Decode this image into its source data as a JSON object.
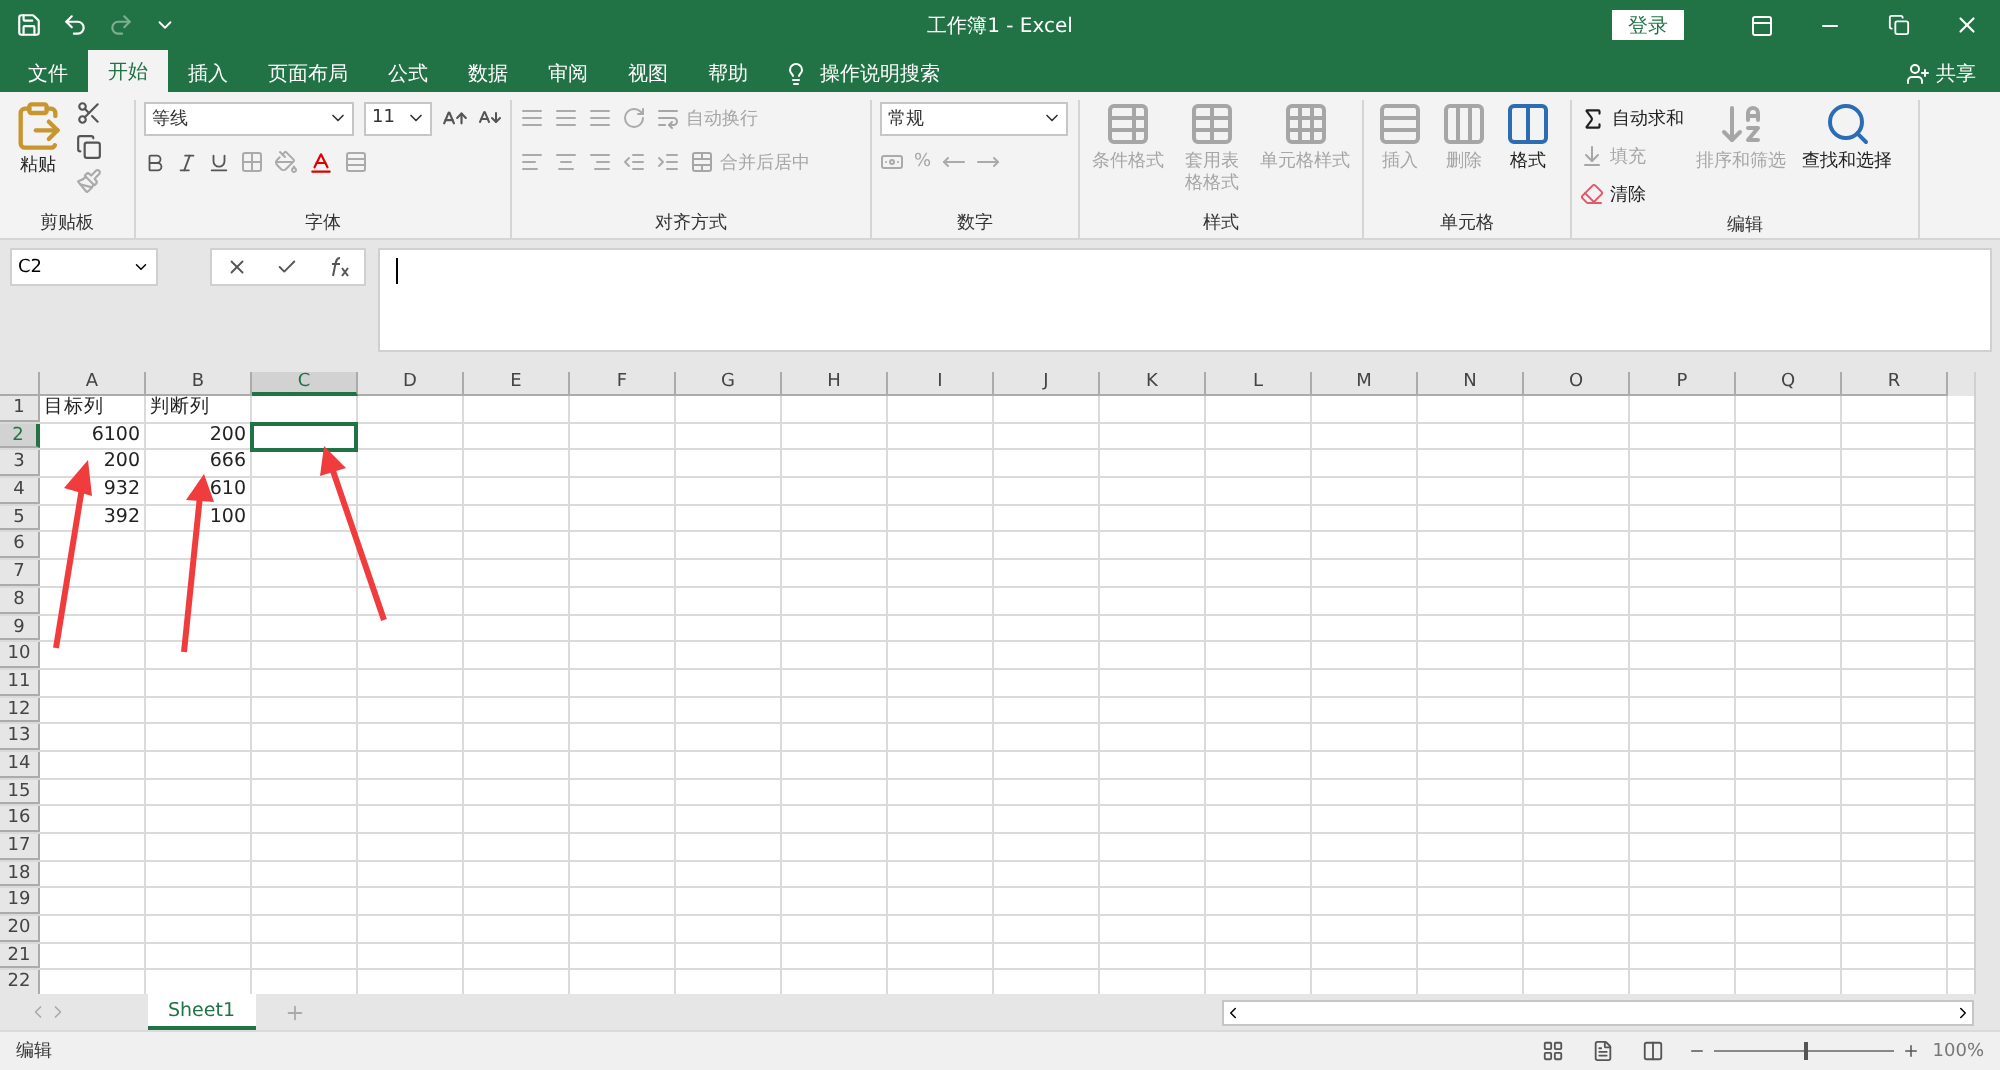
{
  "title_bar": {
    "title": "工作簿1 - Excel",
    "sign_in": "登录"
  },
  "tabs": [
    {
      "label": "文件",
      "selected": false
    },
    {
      "label": "开始",
      "selected": true
    },
    {
      "label": "插入",
      "selected": false
    },
    {
      "label": "页面布局",
      "selected": false
    },
    {
      "label": "公式",
      "selected": false
    },
    {
      "label": "数据",
      "selected": false
    },
    {
      "label": "审阅",
      "selected": false
    },
    {
      "label": "视图",
      "selected": false
    },
    {
      "label": "帮助",
      "selected": false
    }
  ],
  "tell_me": "操作说明搜索",
  "share": "共享",
  "ribbon": {
    "clipboard": {
      "paste": "粘贴",
      "label": "剪贴板"
    },
    "font": {
      "name": "等线",
      "size": "11",
      "label": "字体"
    },
    "alignment": {
      "wrap": "自动换行",
      "merge": "合并后居中",
      "label": "对齐方式"
    },
    "number": {
      "format": "常规",
      "percent": "%",
      "label": "数字"
    },
    "styles": {
      "label": "样式",
      "items": [
        {
          "label": "条件格式",
          "disabled": true
        },
        {
          "label": "套用表格格式",
          "disabled": true
        },
        {
          "label": "单元格样式",
          "disabled": true
        }
      ]
    },
    "cells": {
      "label": "单元格",
      "items": [
        {
          "label": "插入",
          "disabled": true
        },
        {
          "label": "删除",
          "disabled": true
        },
        {
          "label": "格式",
          "disabled": false
        }
      ]
    },
    "editing": {
      "label": "编辑",
      "autosum": {
        "label": "自动求和",
        "disabled": false
      },
      "fill": {
        "label": "填充",
        "disabled": true
      },
      "clear": {
        "label": "清除",
        "disabled": false
      },
      "sort": {
        "label": "排序和筛选",
        "disabled": true
      },
      "find": {
        "label": "查找和选择",
        "disabled": false
      }
    }
  },
  "name_box": "C2",
  "sheet": {
    "columns": [
      {
        "label": "A",
        "selected": false
      },
      {
        "label": "B",
        "selected": false
      },
      {
        "label": "C",
        "selected": true
      },
      {
        "label": "D",
        "selected": false
      },
      {
        "label": "E",
        "selected": false
      },
      {
        "label": "F",
        "selected": false
      },
      {
        "label": "G",
        "selected": false
      },
      {
        "label": "H",
        "selected": false
      },
      {
        "label": "I",
        "selected": false
      },
      {
        "label": "J",
        "selected": false
      },
      {
        "label": "K",
        "selected": false
      },
      {
        "label": "L",
        "selected": false
      },
      {
        "label": "M",
        "selected": false
      },
      {
        "label": "N",
        "selected": false
      },
      {
        "label": "O",
        "selected": false
      },
      {
        "label": "P",
        "selected": false
      },
      {
        "label": "Q",
        "selected": false
      },
      {
        "label": "R",
        "selected": false
      }
    ],
    "rows": [
      {
        "number": "1",
        "selected": false,
        "cells": [
          {
            "text": "目标列",
            "kind": "text"
          },
          {
            "text": "判断列",
            "kind": "text"
          }
        ]
      },
      {
        "number": "2",
        "selected": true,
        "cells": [
          {
            "text": "6100",
            "kind": "number"
          },
          {
            "text": "200",
            "kind": "number"
          }
        ]
      },
      {
        "number": "3",
        "selected": false,
        "cells": [
          {
            "text": "200",
            "kind": "number"
          },
          {
            "text": "666",
            "kind": "number"
          }
        ]
      },
      {
        "number": "4",
        "selected": false,
        "cells": [
          {
            "text": "932",
            "kind": "number"
          },
          {
            "text": "610",
            "kind": "number"
          }
        ]
      },
      {
        "number": "5",
        "selected": false,
        "cells": [
          {
            "text": "392",
            "kind": "number"
          },
          {
            "text": "100",
            "kind": "number"
          }
        ]
      },
      {
        "number": "6",
        "selected": false
      },
      {
        "number": "7",
        "selected": false
      },
      {
        "number": "8",
        "selected": false
      },
      {
        "number": "9",
        "selected": false
      },
      {
        "number": "10",
        "selected": false
      },
      {
        "number": "11",
        "selected": false
      },
      {
        "number": "12",
        "selected": false
      },
      {
        "number": "13",
        "selected": false
      },
      {
        "number": "14",
        "selected": false
      },
      {
        "number": "15",
        "selected": false
      },
      {
        "number": "16",
        "selected": false
      },
      {
        "number": "17",
        "selected": false
      },
      {
        "number": "18",
        "selected": false
      },
      {
        "number": "19",
        "selected": false
      },
      {
        "number": "20",
        "selected": false
      },
      {
        "number": "21",
        "selected": false
      },
      {
        "number": "22",
        "selected": false
      }
    ]
  },
  "sheet_tabs": [
    {
      "label": "Sheet1",
      "selected": true
    }
  ],
  "status": "编辑",
  "zoom": {
    "level": 0.5,
    "reading": "100%"
  }
}
